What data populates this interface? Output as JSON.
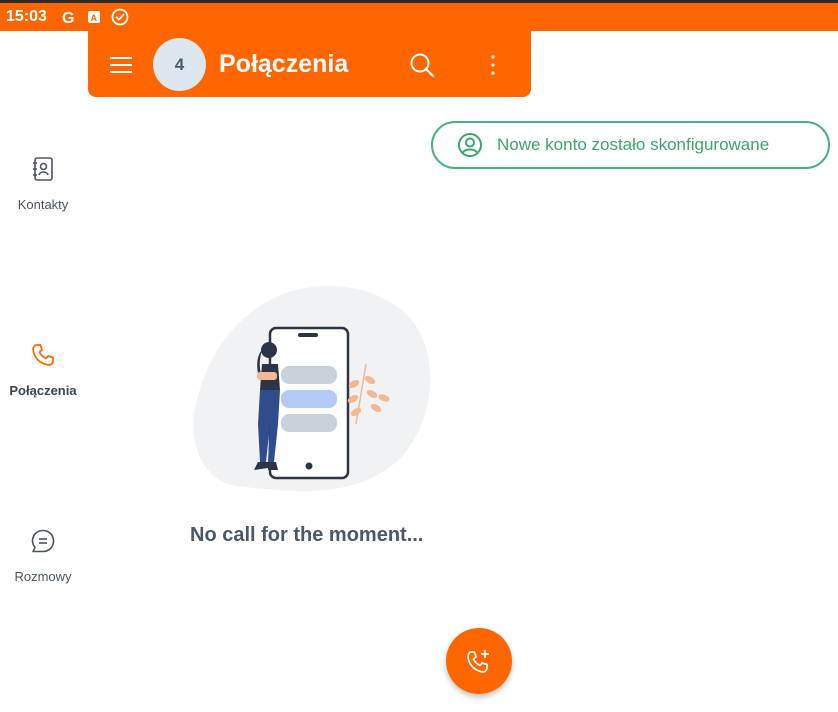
{
  "status_bar": {
    "time": "15:03",
    "icons": [
      "google-icon",
      "a-badge-icon",
      "check-circle-icon"
    ]
  },
  "app_bar": {
    "avatar_count": "4",
    "title": "Połączenia",
    "icons": [
      "menu-icon",
      "search-icon",
      "more-vert-icon"
    ]
  },
  "toast": {
    "text": "Nowe konto zostało skonfigurowane",
    "icon": "account-circle-icon"
  },
  "nav": {
    "items": [
      {
        "label": "Kontakty",
        "icon": "contacts-book-icon",
        "active": false
      },
      {
        "label": "Połączenia",
        "icon": "phone-icon",
        "active": true
      },
      {
        "label": "Rozmowy",
        "icon": "chat-bubble-icon",
        "active": false
      }
    ]
  },
  "empty_state": {
    "message": "No call for the moment..."
  },
  "fab": {
    "icon": "phone-plus-icon"
  },
  "colors": {
    "brand": "#ff6600",
    "success": "#4caf7d",
    "text_dark": "#4a5868"
  }
}
